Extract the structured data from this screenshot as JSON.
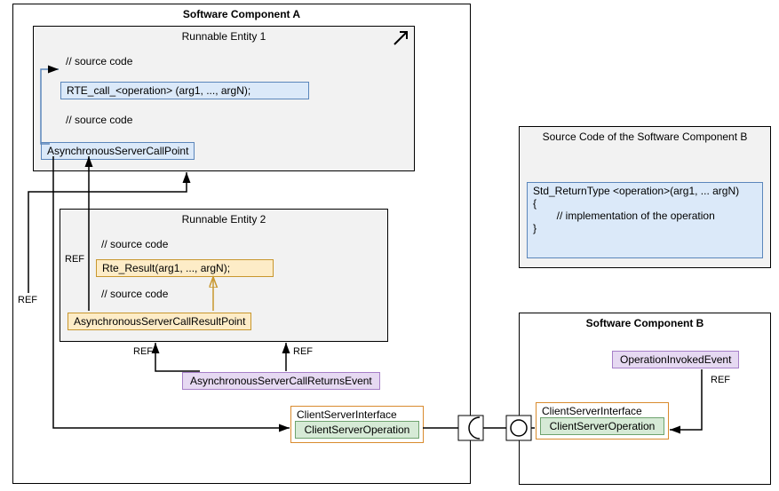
{
  "colors": {
    "blue_fill": "#dbe9f9",
    "blue_border": "#5b86bb",
    "yellow_fill": "#fdecc7",
    "yellow_border": "#c8972e",
    "purple_fill": "#e6d9f2",
    "purple_border": "#a67fc8",
    "green_fill": "#d6ead6",
    "green_border": "#6ea36e",
    "orange_border": "#d98b2e",
    "gray_fill": "#f2f2f2"
  },
  "componentA": {
    "title": "Software Component A",
    "runnable1": {
      "title": "Runnable Entity 1",
      "src1": "// source code",
      "call": "RTE_call_<operation> (arg1, ..., argN);",
      "src2": "// source code",
      "asyncPoint": "AsynchronousServerCallPoint"
    },
    "runnable2": {
      "title": "Runnable Entity 2",
      "src1": "// source code",
      "result": "Rte_Result(arg1, ..., argN);",
      "src2": "// source code",
      "resultPoint": "AsynchronousServerCallResultPoint"
    },
    "returnsEvent": "AsynchronousServerCallReturnsEvent",
    "csInterface": "ClientServerInterface",
    "csOperation": "ClientServerOperation"
  },
  "componentB": {
    "title": "Software Component B",
    "opInvokedEvent": "OperationInvokedEvent",
    "csInterface": "ClientServerInterface",
    "csOperation": "ClientServerOperation",
    "source": {
      "title": "Source Code of the Software Component B",
      "line1": "Std_ReturnType <operation>(arg1, ... argN)",
      "line2": "{",
      "line3": "        // implementation of the operation",
      "line4": "}"
    }
  },
  "labels": {
    "ref": "REF"
  }
}
